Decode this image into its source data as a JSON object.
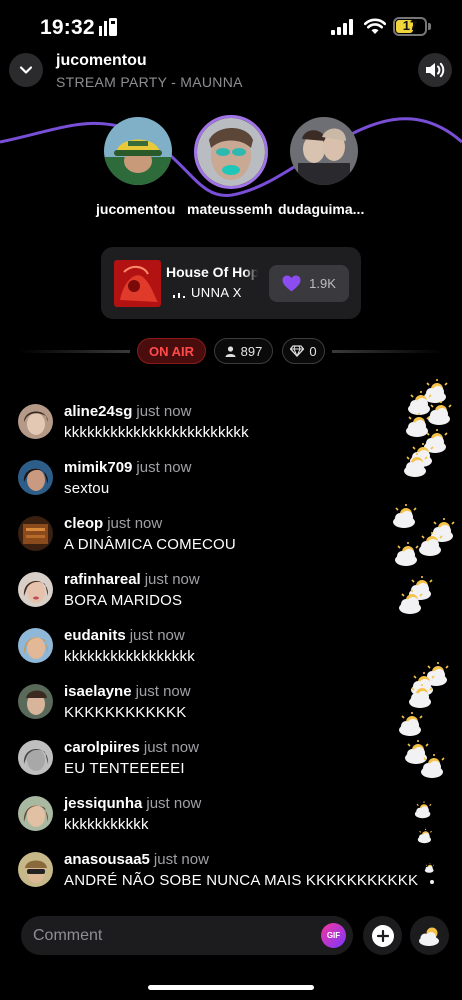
{
  "status_bar": {
    "time": "19:32",
    "battery": "17",
    "battery_color": "#f2d53b"
  },
  "header": {
    "host": "jucomentou",
    "subtitle": "STREAM PARTY - MAUNNA",
    "collapse_icon": "chevron-down-icon",
    "sound_icon": "speaker-icon"
  },
  "speakers": [
    {
      "name": "jucomentou"
    },
    {
      "name": "mateussemh"
    },
    {
      "name": "dudaguima..."
    }
  ],
  "accent_color": "#a274e8",
  "now_playing": {
    "title": "House Of Hope",
    "artist": "UNNA X",
    "likes": "1.9K",
    "like_icon": "heart-icon"
  },
  "stats": {
    "on_air": "ON AIR",
    "viewers": "897",
    "gems": "0",
    "on_air_color": "#ff4b4b"
  },
  "chat": [
    {
      "user": "aline24sg",
      "when": "just now",
      "text": "kkkkkkkkkkkkkkkkkkkkkkkk"
    },
    {
      "user": "mimik709",
      "when": "just now",
      "text": "sextou"
    },
    {
      "user": "cleop",
      "when": "just now",
      "text": "A DINÂMICA COMECOU"
    },
    {
      "user": "rafinhareal",
      "when": "just now",
      "text": "BORA MARIDOS"
    },
    {
      "user": "eudanits",
      "when": "just now",
      "text": "kkkkkkkkkkkkkkkkk"
    },
    {
      "user": "isaelayne",
      "when": "just now",
      "text": "KKKKKKKKKKKK"
    },
    {
      "user": "carolpiires",
      "when": "just now",
      "text": "EU TENTEEEEEI"
    },
    {
      "user": "jessiqunha",
      "when": "just now",
      "text": "kkkkkkkkkkk"
    },
    {
      "user": "anasousaa5",
      "when": "just now",
      "text": "ANDRÉ NÃO SOBE NUNCA MAIS KKKKKKKKKKK"
    }
  ],
  "composer": {
    "placeholder": "Comment",
    "gif_label": "GIF",
    "plus_icon": "plus-icon",
    "reaction_icon": "sun-cloud-icon"
  }
}
